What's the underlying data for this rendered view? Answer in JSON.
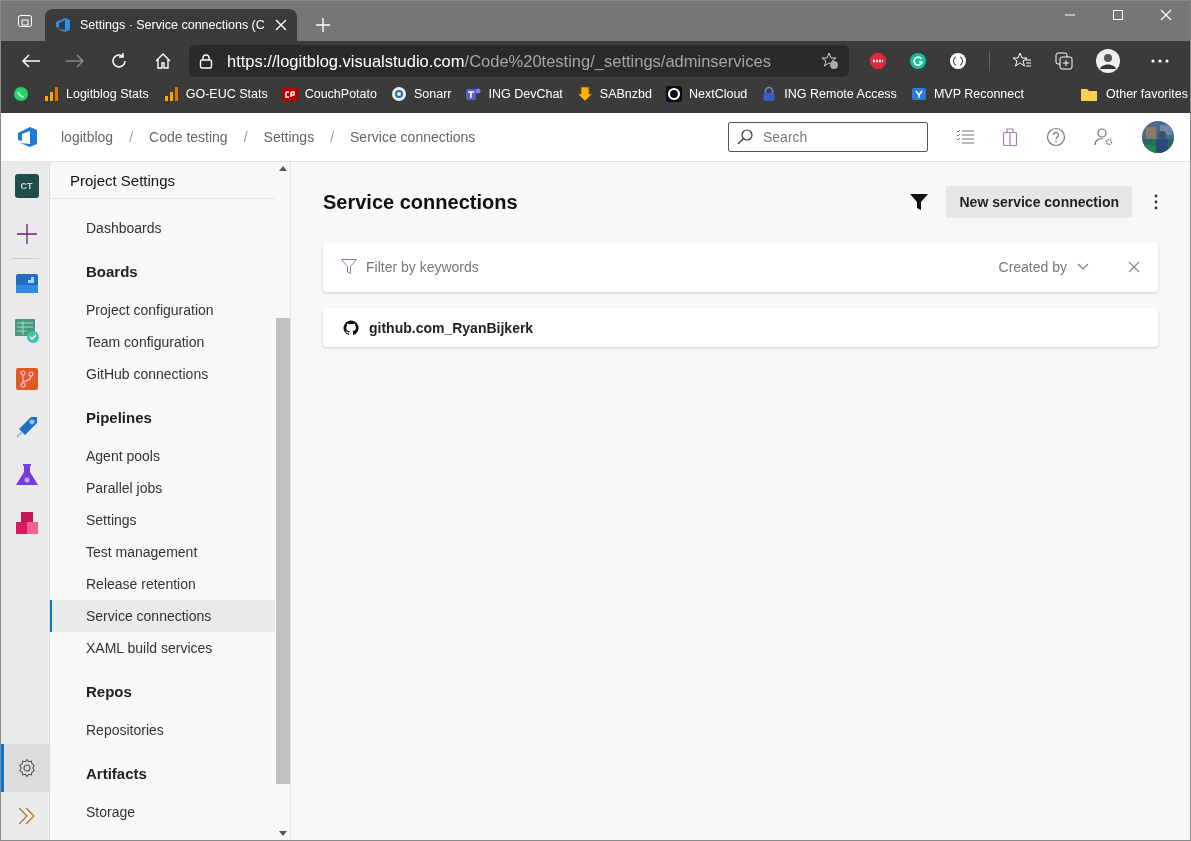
{
  "browser": {
    "tab": {
      "title": "Settings · Service connections (C",
      "selected": true
    },
    "url": {
      "host": "https://logitblog.visualstudio.com",
      "path": "/Code%20testing/_settings/adminservices"
    },
    "bookmarks": [
      {
        "kind": "chat"
      },
      {
        "kind": "bars",
        "label": "Logitblog Stats"
      },
      {
        "kind": "bars",
        "label": "GO-EUC Stats"
      },
      {
        "kind": "cp",
        "label": "CouchPotato"
      },
      {
        "kind": "ring",
        "label": "Sonarr"
      },
      {
        "kind": "team",
        "label": "ING DevChat"
      },
      {
        "kind": "down",
        "label": "SABnzbd"
      },
      {
        "kind": "circle",
        "label": "NextCloud"
      },
      {
        "kind": "lock",
        "label": "ING Remote Access"
      },
      {
        "kind": "square",
        "label": "MVP Reconnect"
      }
    ],
    "other_favorites": "Other favorites"
  },
  "header": {
    "separator": "/",
    "breadcrumbs": [
      "logitblog",
      "Code testing",
      "Settings",
      "Service connections"
    ],
    "search": {
      "placeholder": "Search"
    }
  },
  "rail": [
    {
      "kind": "project",
      "label": "CT",
      "selected": false
    },
    {
      "kind": "plus",
      "selected": false
    },
    {
      "kind": "boards",
      "selected": false
    },
    {
      "kind": "testplans",
      "selected": false
    },
    {
      "kind": "repos",
      "selected": false
    },
    {
      "kind": "pipelines",
      "selected": false
    },
    {
      "kind": "flask",
      "selected": false
    },
    {
      "kind": "artifacts",
      "selected": false
    },
    {
      "kind": "gear",
      "selected": true
    },
    {
      "kind": "expand",
      "selected": false
    }
  ],
  "nav": {
    "title": "Project Settings",
    "sections": [
      {
        "items": [
          {
            "label": "Dashboards",
            "selected": false
          }
        ]
      },
      {
        "heading": "Boards",
        "items": [
          {
            "label": "Project configuration",
            "selected": false
          },
          {
            "label": "Team configuration",
            "selected": false
          },
          {
            "label": "GitHub connections",
            "selected": false
          }
        ]
      },
      {
        "heading": "Pipelines",
        "items": [
          {
            "label": "Agent pools",
            "selected": false
          },
          {
            "label": "Parallel jobs",
            "selected": false
          },
          {
            "label": "Settings",
            "selected": false
          },
          {
            "label": "Test management",
            "selected": false
          },
          {
            "label": "Release retention",
            "selected": false
          },
          {
            "label": "Service connections",
            "selected": true
          },
          {
            "label": "XAML build services",
            "selected": false
          }
        ]
      },
      {
        "heading": "Repos",
        "items": [
          {
            "label": "Repositories",
            "selected": false
          }
        ]
      },
      {
        "heading": "Artifacts",
        "items": [
          {
            "label": "Storage",
            "selected": false
          }
        ]
      }
    ]
  },
  "main": {
    "title": "Service connections",
    "new_button": "New service connection",
    "filter": {
      "placeholder": "Filter by keywords",
      "created_by": "Created by"
    },
    "connections": [
      {
        "name": "github.com_RyanBijkerk"
      }
    ]
  }
}
